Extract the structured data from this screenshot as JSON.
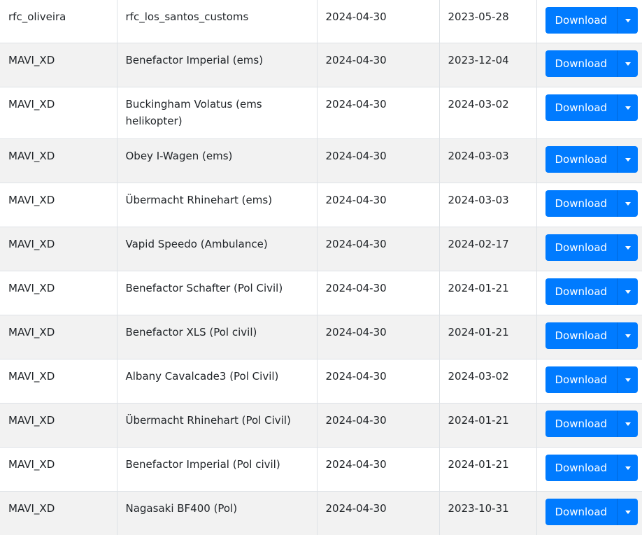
{
  "rows": [
    {
      "author": "rfc_oliveira",
      "name": "rfc_los_santos_customs",
      "updated": "2024-04-30",
      "created": "2023-05-28",
      "download_label": "Download"
    },
    {
      "author": "MAVI_XD",
      "name": "Benefactor Imperial (ems)",
      "updated": "2024-04-30",
      "created": "2023-12-04",
      "download_label": "Download"
    },
    {
      "author": "MAVI_XD",
      "name": "Buckingham Volatus (ems helikopter)",
      "updated": "2024-04-30",
      "created": "2024-03-02",
      "download_label": "Download"
    },
    {
      "author": "MAVI_XD",
      "name": "Obey I-Wagen (ems)",
      "updated": "2024-04-30",
      "created": "2024-03-03",
      "download_label": "Download"
    },
    {
      "author": "MAVI_XD",
      "name": "Übermacht Rhinehart (ems)",
      "updated": "2024-04-30",
      "created": "2024-03-03",
      "download_label": "Download"
    },
    {
      "author": "MAVI_XD",
      "name": "Vapid Speedo (Ambulance)",
      "updated": "2024-04-30",
      "created": "2024-02-17",
      "download_label": "Download"
    },
    {
      "author": "MAVI_XD",
      "name": "Benefactor Schafter (Pol Civil)",
      "updated": "2024-04-30",
      "created": "2024-01-21",
      "download_label": "Download"
    },
    {
      "author": "MAVI_XD",
      "name": "Benefactor XLS (Pol civil)",
      "updated": "2024-04-30",
      "created": "2024-01-21",
      "download_label": "Download"
    },
    {
      "author": "MAVI_XD",
      "name": "Albany Cavalcade3 (Pol Civil)",
      "updated": "2024-04-30",
      "created": "2024-03-02",
      "download_label": "Download"
    },
    {
      "author": "MAVI_XD",
      "name": "Übermacht Rhinehart (Pol Civil)",
      "updated": "2024-04-30",
      "created": "2024-01-21",
      "download_label": "Download"
    },
    {
      "author": "MAVI_XD",
      "name": "Benefactor Imperial (Pol civil)",
      "updated": "2024-04-30",
      "created": "2024-01-21",
      "download_label": "Download"
    },
    {
      "author": "MAVI_XD",
      "name": "Nagasaki BF400 (Pol)",
      "updated": "2024-04-30",
      "created": "2023-10-31",
      "download_label": "Download"
    }
  ],
  "colors": {
    "primary": "#007bff",
    "stripe": "#f2f2f2",
    "border": "#dee2e6",
    "text": "#212529"
  }
}
